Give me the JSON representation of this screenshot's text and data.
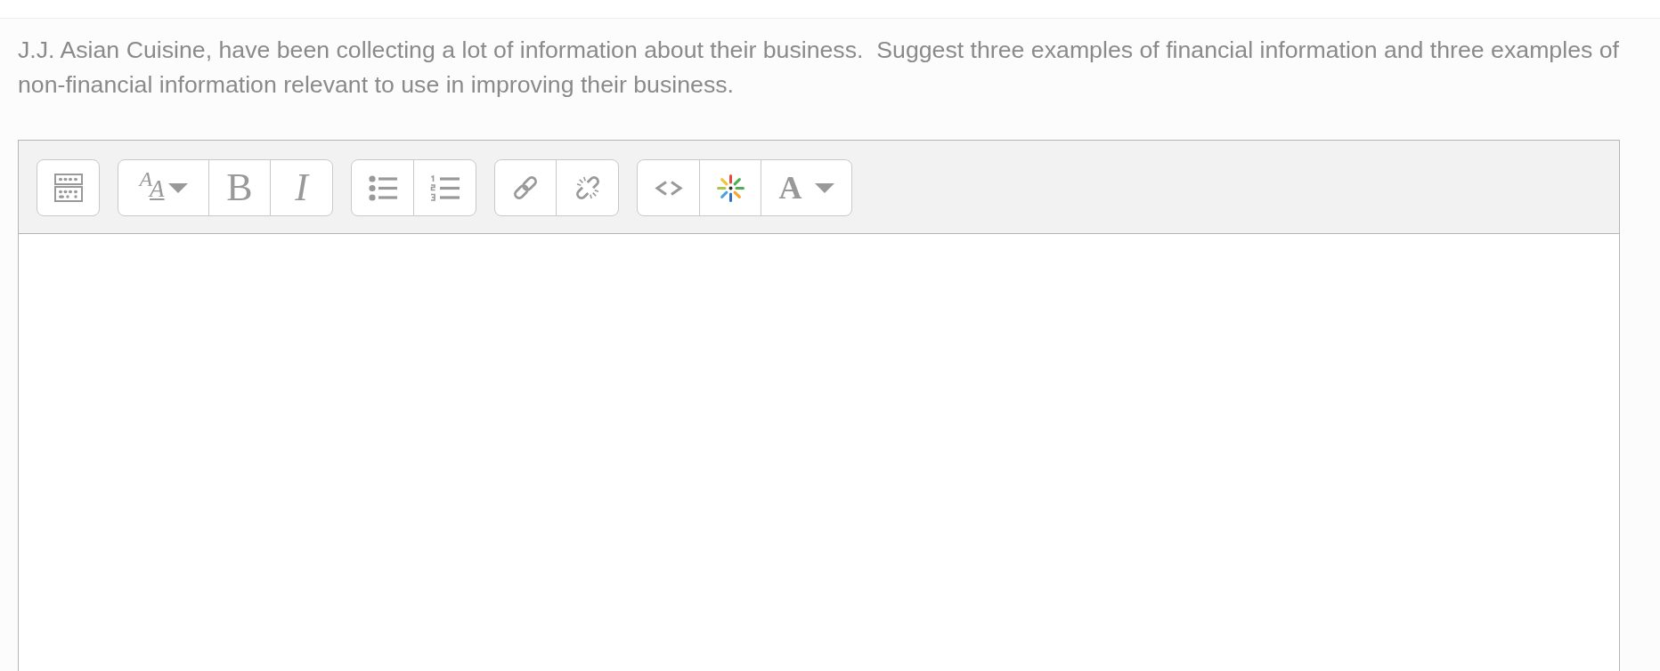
{
  "question": {
    "text": "J.J. Asian Cuisine, have been collecting a lot of information about their business.  Suggest three examples of financial information and three examples of non-financial information relevant to use in improving their business."
  },
  "editor": {
    "toolbar": [
      {
        "buttons": [
          {
            "kind": "collapse"
          }
        ]
      },
      {
        "buttons": [
          {
            "kind": "font-size",
            "glyphs": [
              "A",
              "A"
            ]
          },
          {
            "kind": "bold",
            "glyph": "B"
          },
          {
            "kind": "italic",
            "glyph": "I"
          }
        ]
      },
      {
        "buttons": [
          {
            "kind": "bullet-list"
          },
          {
            "kind": "numbered-list"
          }
        ]
      },
      {
        "buttons": [
          {
            "kind": "link"
          },
          {
            "kind": "unlink"
          }
        ]
      },
      {
        "buttons": [
          {
            "kind": "code"
          },
          {
            "kind": "sparkle"
          },
          {
            "kind": "text-color",
            "glyph": "A"
          }
        ]
      }
    ]
  }
}
